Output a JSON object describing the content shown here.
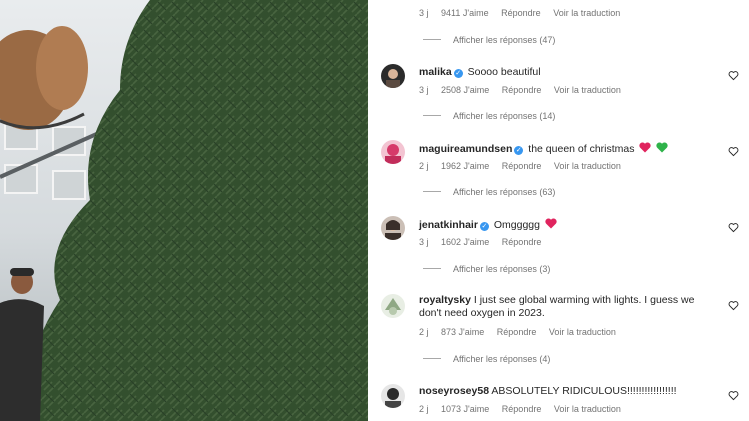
{
  "post": {
    "top_meta": {
      "time": "3 j",
      "likes": "9411 J'aime",
      "reply": "Répondre",
      "translate": "Voir la traduction"
    },
    "top_replies": "Afficher les réponses (47)"
  },
  "comments": [
    {
      "username": "malika",
      "verified": true,
      "text": "Soooo beautiful",
      "time": "3 j",
      "likes": "2508 J'aime",
      "reply": "Répondre",
      "translate": "Voir la traduction",
      "replies": "Afficher les réponses (14)",
      "avatar_color": "#2b2b2b"
    },
    {
      "username": "maguireamundsen",
      "verified": true,
      "text": "the queen of christmas",
      "emoji": [
        "red-heart",
        "green-heart"
      ],
      "time": "2 j",
      "likes": "1962 J'aime",
      "reply": "Répondre",
      "translate": "Voir la traduction",
      "replies": "Afficher les réponses (63)",
      "avatar_color": "#d63a6a"
    },
    {
      "username": "jenatkinhair",
      "verified": true,
      "text": "Omggggg",
      "emoji": [
        "red-heart"
      ],
      "time": "3 j",
      "likes": "1602 J'aime",
      "reply": "Répondre",
      "replies": "Afficher les réponses (3)",
      "avatar_color": "#3a2f2a"
    },
    {
      "username": "royaltysky",
      "verified": false,
      "text": "I just see global warming with lights. I guess we don't need oxygen in 2023.",
      "time": "2 j",
      "likes": "873 J'aime",
      "reply": "Répondre",
      "translate": "Voir la traduction",
      "replies": "Afficher les réponses (4)",
      "avatar_color": "#c9d4c2"
    },
    {
      "username": "noseyrosey58",
      "verified": false,
      "text": "ABSOLUTELY RIDICULOUS!!!!!!!!!!!!!!!!!",
      "time": "2 j",
      "likes": "1073 J'aime",
      "reply": "Répondre",
      "translate": "Voir la traduction",
      "avatar_color": "#2a2a2a"
    }
  ],
  "colors": {
    "verified": "#3897f0",
    "muted_text": "#737373",
    "text": "#262626",
    "heart_red": "#e0245e",
    "heart_green": "#2fb34a"
  }
}
